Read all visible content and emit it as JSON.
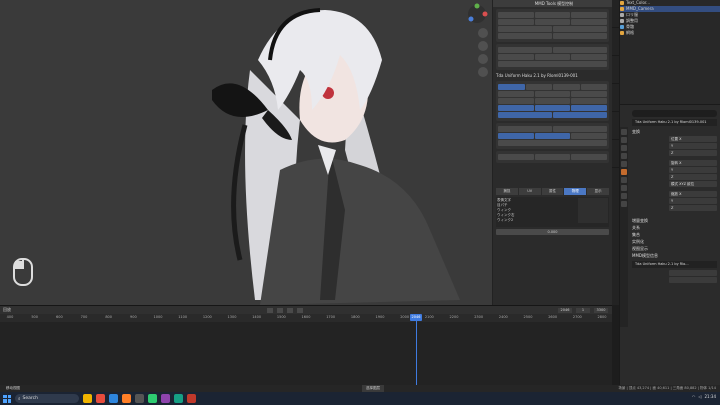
{
  "npanel": {
    "title": "MMD Tools 模型控制",
    "tabs": [
      "捕捉",
      "UV",
      "属性",
      "物理",
      "显示"
    ],
    "active_tab": "物理",
    "list_items": [
      "表情文字",
      "目パチ",
      "ウィンク",
      "ウィンク右",
      "ウィンク2"
    ],
    "model_name": "Tda Uniform Haku 2.1 by Rloml0139-001",
    "shape_values": [
      "0.000"
    ]
  },
  "outliner": {
    "items": [
      "Text_Color...",
      "MMD_Camera",
      "ロリ服",
      "調整用",
      "骨骼",
      "網格"
    ]
  },
  "properties": {
    "object_name": "Tda Uniform Haku 2.1 by Rloml0139-001",
    "fields": [
      "位置 X",
      "Y",
      "Z",
      "旋转 X",
      "Y",
      "Z",
      "模式 XYZ 欧拉",
      "缩放 X",
      "Y",
      "Z"
    ],
    "mmd_display": "Tda Uniform Haku 2.1 by Rlo...",
    "sections": [
      "变换",
      "增量变换",
      "关系",
      "集合",
      "实例化",
      "视图显示",
      "MMD模型信息"
    ]
  },
  "timeline": {
    "header_label": "回放",
    "current_frame": "2046",
    "start_frame": "1",
    "end_frame": "3300",
    "ticks": [
      "400",
      "500",
      "600",
      "700",
      "800",
      "900",
      "1000",
      "1100",
      "1200",
      "1300",
      "1400",
      "1500",
      "1600",
      "1700",
      "1800",
      "1900",
      "2000",
      "2100",
      "2200",
      "2300",
      "2400",
      "2500",
      "2600",
      "2700",
      "2800"
    ]
  },
  "statusbar": {
    "left": "移动视图",
    "mid": "选择图层",
    "right": "场景 | 顶点 43,274 | 面 40,611 | 三角面 80,882 | 物体 1/14"
  },
  "taskbar": {
    "search_placeholder": "Search",
    "time": "21:34"
  }
}
